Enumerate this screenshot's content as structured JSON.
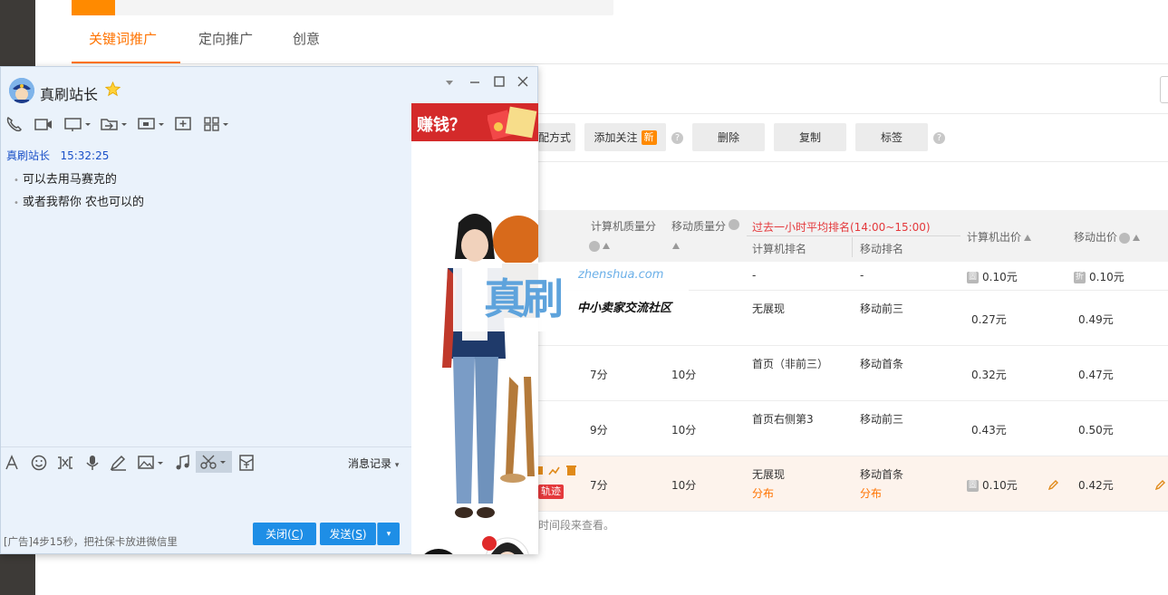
{
  "tabs": [
    "关键词推广",
    "定向推广",
    "创意"
  ],
  "toolbar": {
    "match_label": "配方式",
    "follow_label": "添加关注",
    "new_badge": "新",
    "delete_label": "删除",
    "copy_label": "复制",
    "tag_label": "标签",
    "help_glyph": "?"
  },
  "table": {
    "header": {
      "pc_quality": "计算机质量分",
      "mobile_quality": "移动质量分",
      "rank_group": "过去一小时平均排名(14:00~15:00)",
      "pc_rank": "计算机排名",
      "mobile_rank": "移动排名",
      "pc_price": "计算机出价",
      "mobile_price": "移动出价"
    },
    "rows": [
      {
        "pc_q": "",
        "mob_q": "",
        "pc_rank": "-",
        "mob_rank": "-",
        "pc_price": "0.10元",
        "mob_price": "0.10元",
        "pc_price_icon": "圖",
        "mob_price_icon": "折"
      },
      {
        "pc_q": "",
        "mob_q": "",
        "pc_rank": "无展现",
        "mob_rank": "移动前三",
        "pc_price": "0.27元",
        "mob_price": "0.49元"
      },
      {
        "pc_q": "7分",
        "mob_q": "10分",
        "pc_rank": "首页（非前三）",
        "mob_rank": "移动首条",
        "pc_price": "0.32元",
        "mob_price": "0.47元"
      },
      {
        "pc_q": "9分",
        "mob_q": "10分",
        "pc_rank": "首页右侧第3",
        "mob_rank": "移动前三",
        "pc_price": "0.43元",
        "mob_price": "0.50元"
      },
      {
        "pc_q": "7分",
        "mob_q": "10分",
        "pc_rank": "无展现",
        "mob_rank": "移动首条",
        "pc_sub": "分布",
        "mob_sub": "分布",
        "pc_price": "0.10元",
        "mob_price": "0.42元",
        "pc_price_icon": "圖",
        "track_label": "轨迹"
      }
    ],
    "footnote": "时间段来查看。"
  },
  "chat": {
    "title": "真刷站长",
    "sender": "真刷站长",
    "time": "15:32:25",
    "messages": [
      "可以去用马赛克的",
      "或者我帮你  农也可以的"
    ],
    "msg_record": "消息记录",
    "ad_text": "[广告]4步15秒，把社保卡放进微信里",
    "close_label": "关闭(",
    "close_key": "C",
    "close_end": ")",
    "send_label": "发送(",
    "send_key": "S",
    "send_end": ")",
    "ad_banner_text": "赚钱？"
  },
  "watermark": {
    "big": "真刷",
    "url": "zhenshua.com",
    "sub": "中小卖家交流社区"
  },
  "colors": {
    "accent": "#ff7300",
    "primary_button": "#1e8ee6",
    "red": "#e4393c"
  }
}
